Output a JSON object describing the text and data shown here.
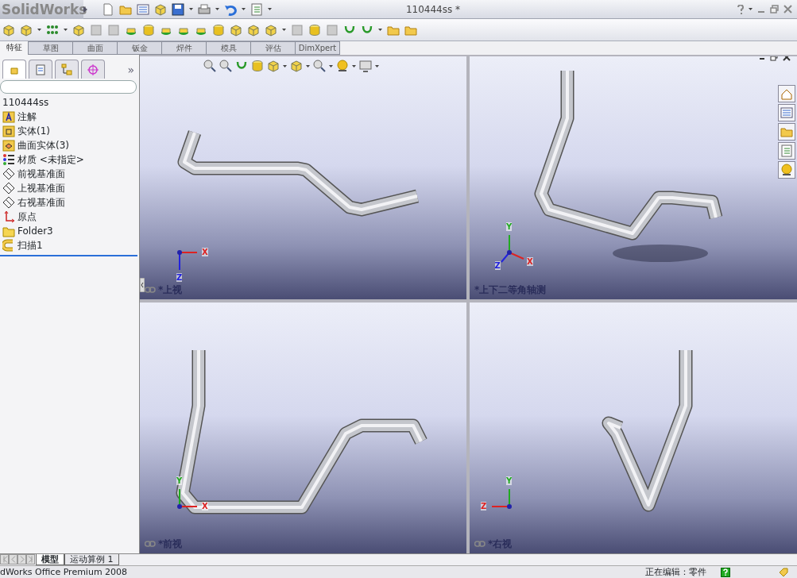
{
  "window": {
    "logo": "**Solid**Works",
    "title": "110444ss *"
  },
  "command_tabs": [
    {
      "label": "特征",
      "selected": true
    },
    {
      "label": "草图",
      "selected": false
    },
    {
      "label": "曲面",
      "selected": false
    },
    {
      "label": "钣金",
      "selected": false
    },
    {
      "label": "焊件",
      "selected": false
    },
    {
      "label": "模具",
      "selected": false
    },
    {
      "label": "评估",
      "selected": false
    },
    {
      "label": "DimXpert",
      "selected": false
    }
  ],
  "panel_tabs": [
    {
      "kind": "tree",
      "selected": true
    },
    {
      "kind": "properties",
      "selected": false
    },
    {
      "kind": "config",
      "selected": false
    },
    {
      "kind": "target",
      "selected": false
    }
  ],
  "panel_more": "»",
  "tree": {
    "root": "110444ss",
    "items": [
      {
        "kind": "annotation",
        "label": "注解"
      },
      {
        "kind": "solid",
        "label": "实体(1)"
      },
      {
        "kind": "surface",
        "label": "曲面实体(3)"
      },
      {
        "kind": "material",
        "label": "材质 <未指定>"
      },
      {
        "kind": "plane",
        "label": "前视基准面"
      },
      {
        "kind": "plane",
        "label": "上视基准面"
      },
      {
        "kind": "plane",
        "label": "右视基准面"
      },
      {
        "kind": "origin",
        "label": "原点"
      },
      {
        "kind": "folder",
        "label": "Folder3"
      },
      {
        "kind": "sweep",
        "label": "扫描1"
      }
    ]
  },
  "viewports": [
    {
      "label": "*上视",
      "linked": true,
      "triad": [
        {
          "label": "X",
          "kind": "right"
        },
        {
          "label": "Z",
          "kind": "down"
        }
      ]
    },
    {
      "label": "*上下二等角轴测",
      "linked": false,
      "triad": [
        {
          "label": "Y",
          "kind": "up"
        },
        {
          "label": "X",
          "kind": "downright"
        },
        {
          "label": "Z",
          "kind": "downleft"
        }
      ]
    },
    {
      "label": "*前视",
      "linked": true,
      "triad": [
        {
          "label": "Y",
          "kind": "up"
        },
        {
          "label": "X",
          "kind": "right"
        }
      ]
    },
    {
      "label": "*右视",
      "linked": true,
      "triad": [
        {
          "label": "Y",
          "kind": "up"
        },
        {
          "label": "Z",
          "kind": "left"
        }
      ]
    }
  ],
  "bottom_tabs": [
    {
      "label": "模型",
      "selected": true
    },
    {
      "label": "运动算例 1",
      "selected": false
    }
  ],
  "status_bar": {
    "product": "dWorks Office Premium 2008",
    "mode": "正在编辑：零件"
  }
}
